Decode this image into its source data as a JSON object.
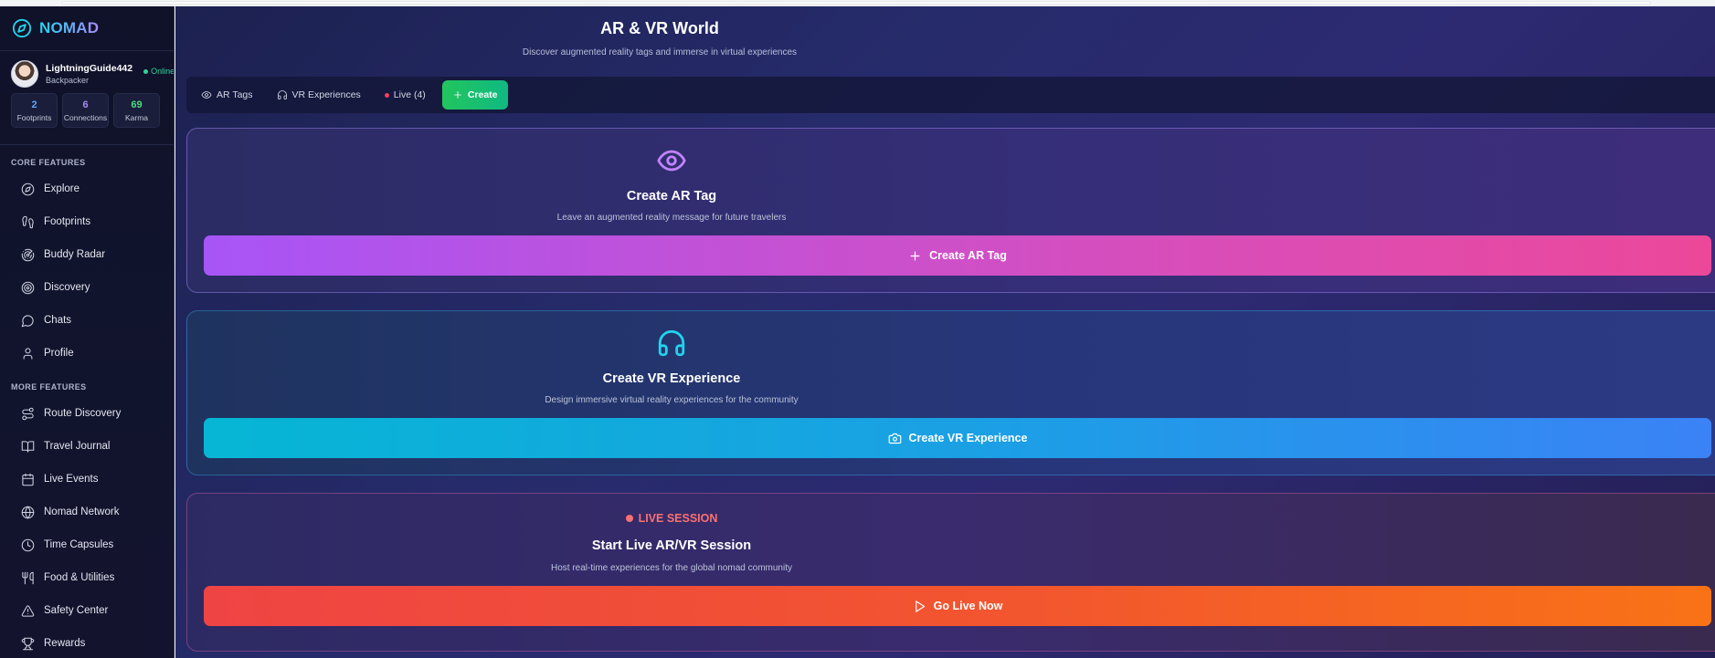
{
  "brand": {
    "name": "NOMAD",
    "icon": "compass-icon"
  },
  "user": {
    "name": "LightningGuide442",
    "role": "Backpacker",
    "status": "Online",
    "stats": [
      {
        "value": "2",
        "label": "Footprints",
        "color": "#60a5fa"
      },
      {
        "value": "6",
        "label": "Connections",
        "color": "#a78bfa"
      },
      {
        "value": "69",
        "label": "Karma",
        "color": "#4ade80"
      }
    ]
  },
  "sidebar": {
    "core_title": "CORE FEATURES",
    "core_items": [
      {
        "label": "Explore",
        "icon": "compass-icon"
      },
      {
        "label": "Footprints",
        "icon": "footprints-icon"
      },
      {
        "label": "Buddy Radar",
        "icon": "radar-icon"
      },
      {
        "label": "Discovery",
        "icon": "target-icon"
      },
      {
        "label": "Chats",
        "icon": "chat-icon"
      },
      {
        "label": "Profile",
        "icon": "user-icon"
      }
    ],
    "more_title": "MORE FEATURES",
    "more_items": [
      {
        "label": "Route Discovery",
        "icon": "route-icon"
      },
      {
        "label": "Travel Journal",
        "icon": "book-icon"
      },
      {
        "label": "Live Events",
        "icon": "calendar-icon"
      },
      {
        "label": "Nomad Network",
        "icon": "globe-icon"
      },
      {
        "label": "Time Capsules",
        "icon": "clock-icon"
      },
      {
        "label": "Food & Utilities",
        "icon": "utensils-icon"
      },
      {
        "label": "Safety Center",
        "icon": "warning-icon"
      },
      {
        "label": "Rewards",
        "icon": "trophy-icon"
      }
    ]
  },
  "header": {
    "title": "AR & VR World",
    "subtitle": "Discover augmented reality tags and immerse in virtual experiences"
  },
  "tabs": {
    "ar_tags": "AR Tags",
    "vr_experiences": "VR Experiences",
    "live": "Live (4)",
    "create": "Create"
  },
  "cards": {
    "ar": {
      "title": "Create AR Tag",
      "subtitle": "Leave an augmented reality message for future travelers",
      "button": "Create AR Tag"
    },
    "vr": {
      "title": "Create VR Experience",
      "subtitle": "Design immersive virtual reality experiences for the community",
      "button": "Create VR Experience"
    },
    "live": {
      "badge": "LIVE SESSION",
      "title": "Start Live AR/VR Session",
      "subtitle": "Host real-time experiences for the global nomad community",
      "button": "Go Live Now"
    }
  },
  "colors": {
    "accent_cyan": "#22d3ee",
    "accent_purple": "#a78bfa",
    "online_green": "#34d399",
    "live_red": "#f87171"
  }
}
